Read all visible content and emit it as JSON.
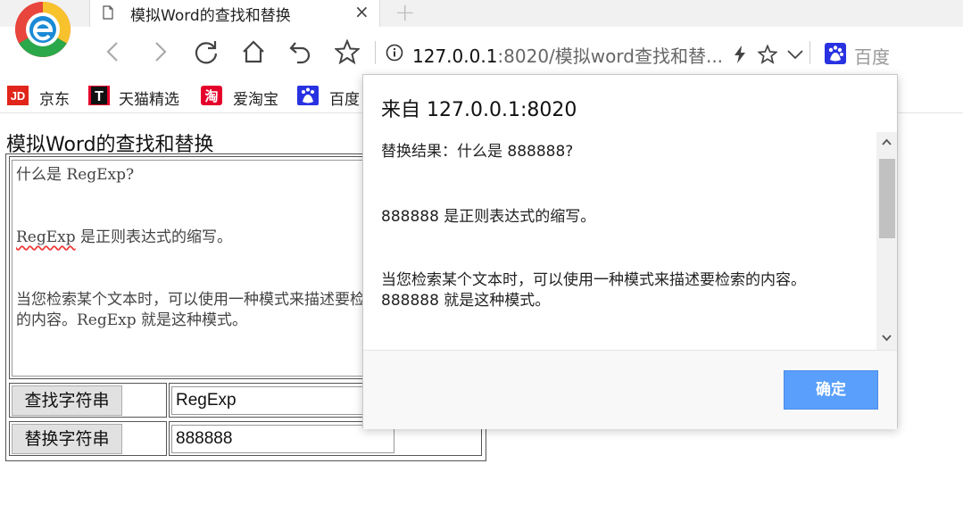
{
  "browser": {
    "tab": {
      "title": "模拟Word的查找和替换",
      "close": "×"
    },
    "new_tab": "+",
    "address": {
      "host": "127.0.0.1",
      "rest": ":8020/模拟word查找和替..."
    },
    "search_engine": "百度",
    "bookmarks": [
      {
        "label": "京东",
        "icon": "jd-icon"
      },
      {
        "label": "天猫精选",
        "icon": "tmall-icon"
      },
      {
        "label": "爱淘宝",
        "icon": "taobao-icon"
      },
      {
        "label": "百度",
        "icon": "baidu-icon"
      }
    ],
    "icon_badges": {
      "jd": "JD",
      "tmall": "T",
      "taobao": "淘"
    },
    "colors": {
      "accent": "#5a9ffb",
      "jd": "#e1251b",
      "tmall": "#e4002b",
      "baidu": "#2932e1"
    }
  },
  "page": {
    "title": "模拟Word的查找和替换",
    "textarea": {
      "line1": "什么是 RegExp?",
      "line2_word": "RegExp",
      "line2_rest": " 是正则表达式的缩写。",
      "line3": "当您检索某个文本时，可以使用一种模式来描述要检索",
      "line4": "的内容。RegExp 就是这种模式。"
    },
    "find_button": "查找字符串",
    "find_value": "RegExp",
    "replace_button": "替换字符串",
    "replace_value": "888888"
  },
  "dialog": {
    "title": "来自 127.0.0.1:8020",
    "lines": [
      "替换结果：什么是 888888?",
      "888888 是正则表达式的缩写。",
      "当您检索某个文本时，可以使用一种模式来描述要检索的内容。",
      "888888 就是这种模式。"
    ],
    "ok_button": "确定"
  }
}
